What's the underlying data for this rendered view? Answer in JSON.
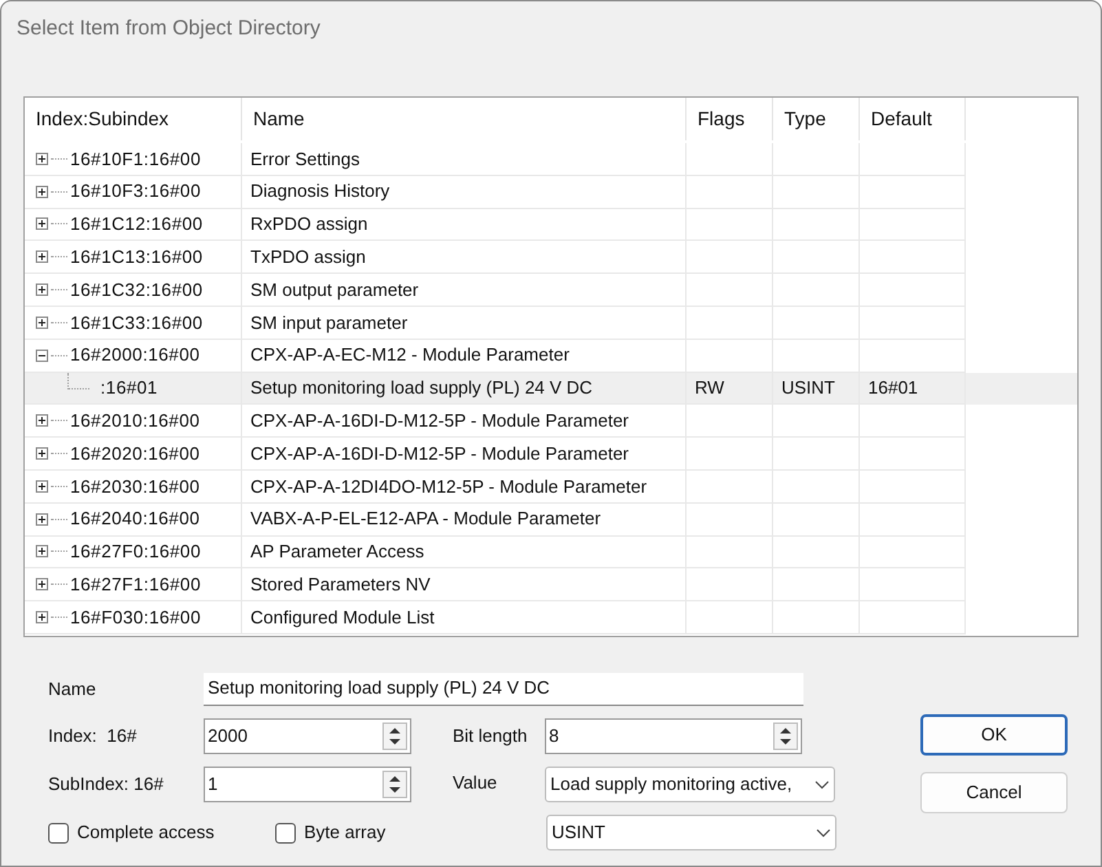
{
  "window": {
    "title": "Select Item from Object Directory"
  },
  "table": {
    "columns": [
      "Index:Subindex",
      "Name",
      "Flags",
      "Type",
      "Default"
    ],
    "rows": [
      {
        "index": "16#10F1:16#00",
        "name": "Error Settings",
        "expanded": false,
        "selected": false
      },
      {
        "index": "16#10F3:16#00",
        "name": "Diagnosis History",
        "expanded": false,
        "selected": false
      },
      {
        "index": "16#1C12:16#00",
        "name": "RxPDO assign",
        "expanded": false,
        "selected": false
      },
      {
        "index": "16#1C13:16#00",
        "name": "TxPDO assign",
        "expanded": false,
        "selected": false
      },
      {
        "index": "16#1C32:16#00",
        "name": "SM output parameter",
        "expanded": false,
        "selected": false
      },
      {
        "index": "16#1C33:16#00",
        "name": "SM input parameter",
        "expanded": false,
        "selected": false
      },
      {
        "index": "16#2000:16#00",
        "name": "CPX-AP-A-EC-M12 - Module Parameter",
        "expanded": true,
        "selected": false,
        "children": [
          {
            "index": ":16#01",
            "name": "Setup monitoring load supply (PL) 24 V DC",
            "flags": "RW",
            "type": "USINT",
            "default": "16#01",
            "selected": true
          }
        ]
      },
      {
        "index": "16#2010:16#00",
        "name": "CPX-AP-A-16DI-D-M12-5P - Module Parameter",
        "expanded": false,
        "selected": false
      },
      {
        "index": "16#2020:16#00",
        "name": "CPX-AP-A-16DI-D-M12-5P - Module Parameter",
        "expanded": false,
        "selected": false
      },
      {
        "index": "16#2030:16#00",
        "name": "CPX-AP-A-12DI4DO-M12-5P - Module Parameter",
        "expanded": false,
        "selected": false
      },
      {
        "index": "16#2040:16#00",
        "name": "VABX-A-P-EL-E12-APA - Module Parameter",
        "expanded": false,
        "selected": false
      },
      {
        "index": "16#27F0:16#00",
        "name": "AP Parameter Access",
        "expanded": false,
        "selected": false
      },
      {
        "index": "16#27F1:16#00",
        "name": "Stored Parameters NV",
        "expanded": false,
        "selected": false
      },
      {
        "index": "16#F030:16#00",
        "name": "Configured Module List",
        "expanded": false,
        "selected": false
      }
    ]
  },
  "form": {
    "name": {
      "label": "Name",
      "value": "Setup monitoring load supply (PL) 24 V DC"
    },
    "index": {
      "label": "Index:  16#",
      "value": "2000"
    },
    "subindex": {
      "label": "SubIndex: 16#",
      "value": "1"
    },
    "bit_length": {
      "label": "Bit length",
      "value": "8"
    },
    "value": {
      "label": "Value",
      "value": "Load supply monitoring active,"
    },
    "type": {
      "value": "USINT"
    },
    "checkboxes": [
      {
        "label": "Complete access",
        "checked": false
      },
      {
        "label": "Byte array",
        "checked": false
      }
    ]
  },
  "buttons": [
    "OK",
    "Cancel"
  ]
}
